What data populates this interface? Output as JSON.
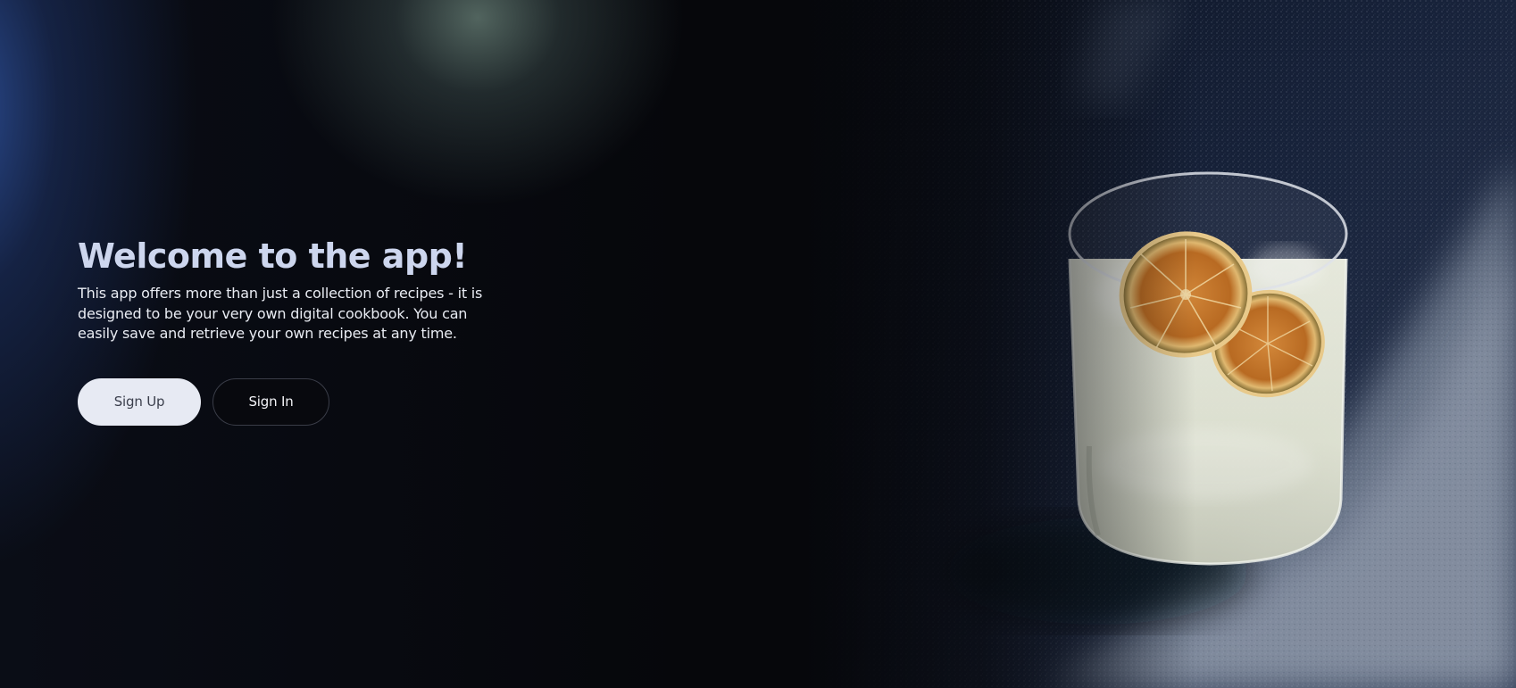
{
  "hero": {
    "title": "Welcome to the app!",
    "description": "This app offers more than just a collection of recipes - it is designed to be your very own digital cookbook. You can easily save and retrieve your own recipes at any time."
  },
  "actions": {
    "sign_up_label": "Sign Up",
    "sign_in_label": "Sign In"
  },
  "theme": {
    "background": "#06070b",
    "accent_blue": "#2c4e96",
    "title_color": "#cdd6ee",
    "primary_button": "#e7eaf3"
  }
}
